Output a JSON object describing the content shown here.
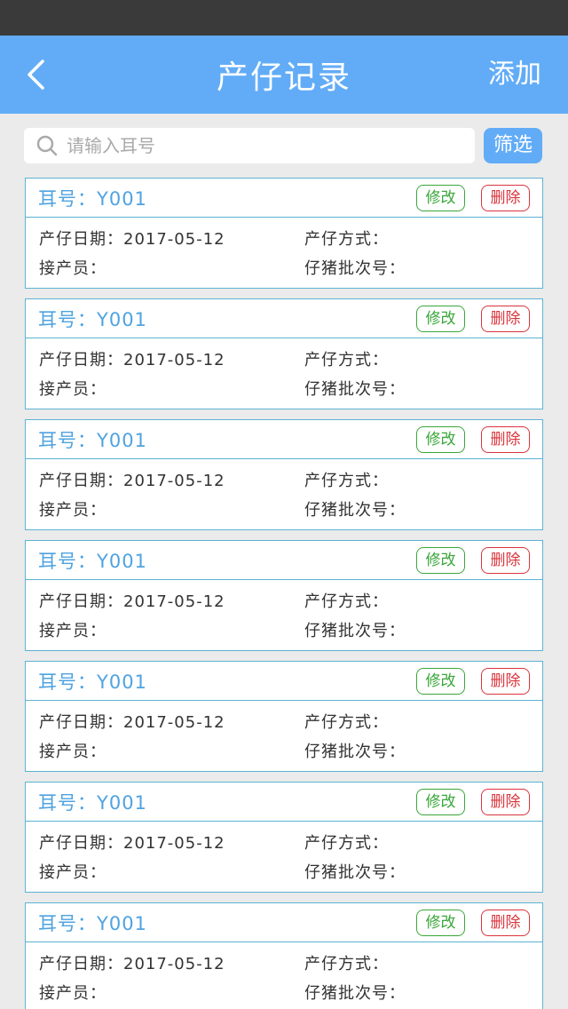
{
  "nav": {
    "title": "产仔记录",
    "add_label": "添加"
  },
  "search": {
    "placeholder": "请输入耳号",
    "filter_label": "筛选"
  },
  "records": [
    {
      "ear": "耳号：Y001",
      "edit_label": "修改",
      "delete_label": "删除",
      "date": "产仔日期：2017-05-12",
      "method": "产仔方式：",
      "staff": "接产员：",
      "batch": "仔猪批次号："
    },
    {
      "ear": "耳号：Y001",
      "edit_label": "修改",
      "delete_label": "删除",
      "date": "产仔日期：2017-05-12",
      "method": "产仔方式：",
      "staff": "接产员：",
      "batch": "仔猪批次号："
    },
    {
      "ear": "耳号：Y001",
      "edit_label": "修改",
      "delete_label": "删除",
      "date": "产仔日期：2017-05-12",
      "method": "产仔方式：",
      "staff": "接产员：",
      "batch": "仔猪批次号："
    },
    {
      "ear": "耳号：Y001",
      "edit_label": "修改",
      "delete_label": "删除",
      "date": "产仔日期：2017-05-12",
      "method": "产仔方式：",
      "staff": "接产员：",
      "batch": "仔猪批次号："
    },
    {
      "ear": "耳号：Y001",
      "edit_label": "修改",
      "delete_label": "删除",
      "date": "产仔日期：2017-05-12",
      "method": "产仔方式：",
      "staff": "接产员：",
      "batch": "仔猪批次号："
    },
    {
      "ear": "耳号：Y001",
      "edit_label": "修改",
      "delete_label": "删除",
      "date": "产仔日期：2017-05-12",
      "method": "产仔方式：",
      "staff": "接产员：",
      "batch": "仔猪批次号："
    },
    {
      "ear": "耳号：Y001",
      "edit_label": "修改",
      "delete_label": "删除",
      "date": "产仔日期：2017-05-12",
      "method": "产仔方式：",
      "staff": "接产员：",
      "batch": "仔猪批次号："
    }
  ],
  "colors": {
    "accent": "#62acf7",
    "edit": "#3aa63a",
    "delete": "#d9343c",
    "border": "#5bb3d3"
  },
  "icons": {
    "back": "chevron-left-icon",
    "search": "search-icon"
  }
}
